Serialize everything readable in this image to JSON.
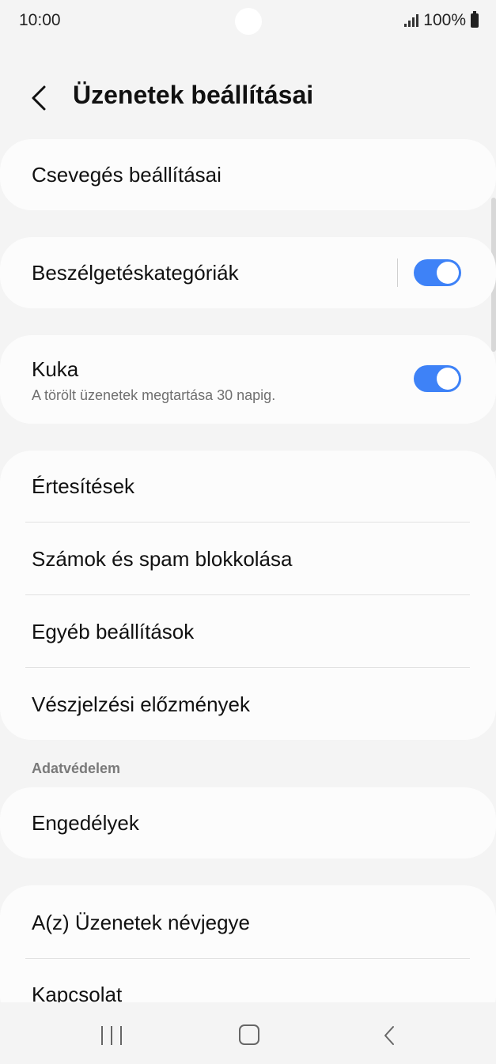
{
  "status_bar": {
    "time": "10:00",
    "battery": "100%"
  },
  "header": {
    "title": "Üzenetek beállításai"
  },
  "items": {
    "chat_settings": "Csevegés beállításai",
    "conversation_categories": "Beszélgetéskategóriák",
    "conversation_categories_enabled": true,
    "trash": "Kuka",
    "trash_desc": "A törölt üzenetek megtartása 30 napig.",
    "trash_enabled": true,
    "notifications": "Értesítések",
    "block_numbers": "Számok és spam blokkolása",
    "other_settings": "Egyéb beállítások",
    "emergency_history": "Vészjelzési előzmények",
    "privacy_section": "Adatvédelem",
    "permissions": "Engedélyek",
    "about": "A(z) Üzenetek névjegye",
    "contact": "Kapcsolat"
  },
  "colors": {
    "accent": "#3e82f7",
    "background": "#f4f4f4",
    "card": "#fcfcfc"
  }
}
